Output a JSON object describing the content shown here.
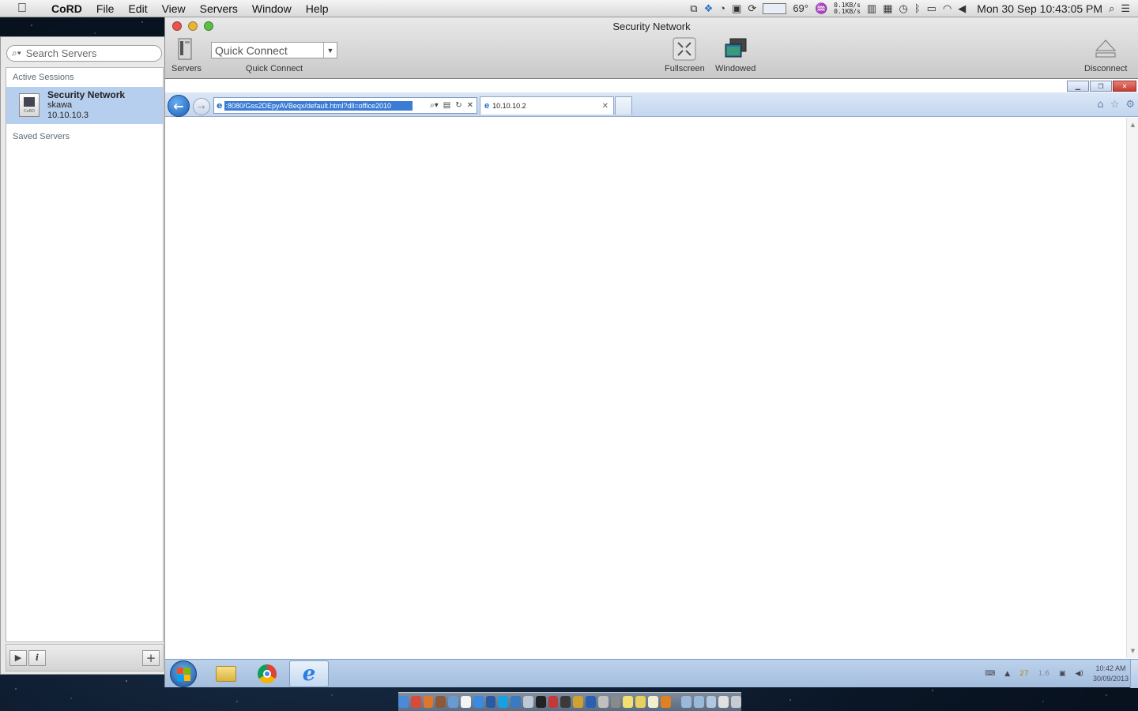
{
  "menubar": {
    "app_name": "CoRD",
    "menus": [
      "File",
      "Edit",
      "View",
      "Servers",
      "Window",
      "Help"
    ],
    "temperature": "69°",
    "net_up": "0.1KB/s",
    "net_down": "0.1KB/s",
    "clock": "Mon 30 Sep  10:43:05 PM"
  },
  "drawer": {
    "search_placeholder": "Search Servers",
    "active_sessions_label": "Active Sessions",
    "saved_servers_label": "Saved Servers",
    "session": {
      "name": "Security Network",
      "user": "skawa",
      "host": "10.10.10.3",
      "icon_caption": "CoRD"
    },
    "play_symbol": "▶",
    "info_symbol": "i",
    "add_symbol": "+"
  },
  "window": {
    "title": "Security Network",
    "servers_label": "Servers",
    "quick_connect_placeholder": "Quick Connect",
    "quick_connect_label": "Quick Connect",
    "fullscreen_label": "Fullscreen",
    "windowed_label": "Windowed",
    "disconnect_label": "Disconnect"
  },
  "remote": {
    "address_url": ":8080/Gss2DEpyAVBeqx/default.html?dll=office2010",
    "tab_title": "10.10.10.2",
    "taskbar": {
      "tray_num1": "27",
      "tray_num2": "1.6",
      "time": "10:42 AM",
      "date": "30/09/2013"
    }
  },
  "colors": {
    "selection": "#b7cfee",
    "ie_toolbar": "#c3d6ef",
    "taskbar": "#a3bddd"
  }
}
